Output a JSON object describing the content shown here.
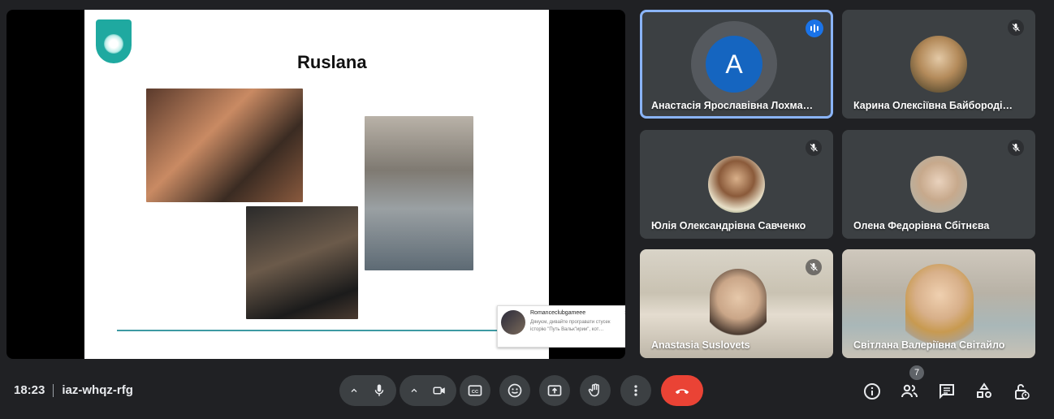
{
  "meeting": {
    "time": "18:23",
    "code": "iaz-whqz-rfg"
  },
  "slide": {
    "title": "Ruslana",
    "notification": {
      "name": "Romanceclubgameee",
      "text": "Дякуєм, дивайте програвати стусек історію \"Путь Вальк\"ирии\", кот…",
      "close": "×"
    }
  },
  "participants": [
    {
      "name": "Анастасія Ярославівна Лохма…",
      "initial": "A",
      "speaking": true
    },
    {
      "name": "Карина Олексіївна Байбороді…",
      "muted": true
    },
    {
      "name": "Юлія Олександрівна Савченко",
      "muted": true
    },
    {
      "name": "Олена Федорівна Сбітнєва",
      "muted": true
    },
    {
      "name": "Anastasia Suslovets",
      "muted": true
    },
    {
      "name": "Світлана Валеріївна Світайло",
      "muted": false
    }
  ],
  "people_count": "7",
  "colors": {
    "accent": "#8ab4f8",
    "end_call": "#ea4335",
    "avatar": "#1565c0"
  }
}
